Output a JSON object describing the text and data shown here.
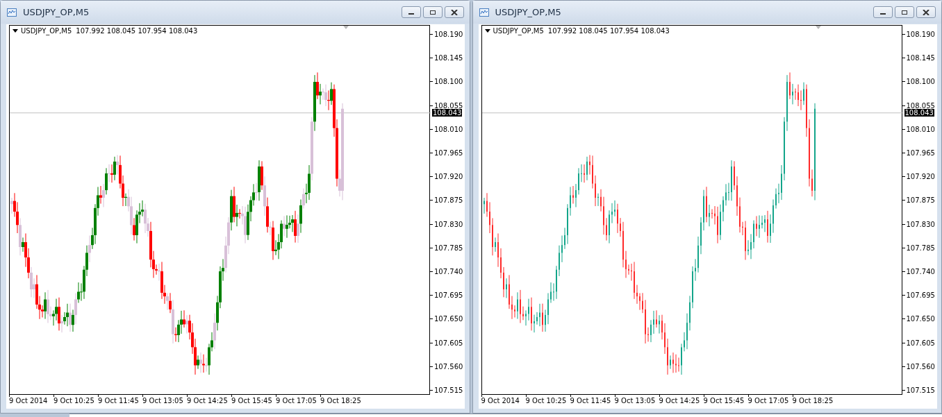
{
  "windows": [
    {
      "title": "USDJPY_OP,M5",
      "kind": "wide",
      "legend": {
        "symbol": "USDJPY_OP,M5",
        "ohlc": "107.992 108.045 107.954 108.043"
      },
      "current_price": "108.043",
      "price_axis": [
        "108.190",
        "108.145",
        "108.100",
        "108.055",
        "108.010",
        "107.965",
        "107.920",
        "107.875",
        "107.830",
        "107.785",
        "107.740",
        "107.695",
        "107.650",
        "107.605",
        "107.560",
        "107.515"
      ],
      "time_axis": [
        "9 Oct 2014",
        "9 Oct 10:25",
        "9 Oct 11:45",
        "9 Oct 13:05",
        "9 Oct 14:25",
        "9 Oct 15:45",
        "9 Oct 17:05",
        "9 Oct 18:25"
      ]
    },
    {
      "title": "USDJPY_OP,M5",
      "kind": "thin",
      "legend": {
        "symbol": "USDJPY_OP,M5",
        "ohlc": "107.992 108.045 107.954 108.043"
      },
      "current_price": "108.043",
      "price_axis": [
        "108.190",
        "108.145",
        "108.100",
        "108.055",
        "108.010",
        "107.965",
        "107.920",
        "107.875",
        "107.830",
        "107.785",
        "107.740",
        "107.695",
        "107.650",
        "107.605",
        "107.560",
        "107.515"
      ],
      "time_axis": [
        "9 Oct 2014",
        "9 Oct 10:25",
        "9 Oct 11:45",
        "9 Oct 13:05",
        "9 Oct 14:25",
        "9 Oct 15:45",
        "9 Oct 17:05",
        "9 Oct 18:25"
      ]
    }
  ]
}
